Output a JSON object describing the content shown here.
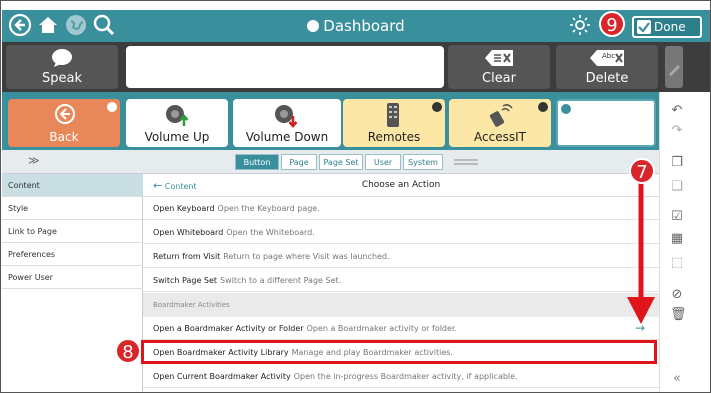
{
  "topbar": {
    "title": "Dashboard",
    "done_label": "Done",
    "icons": [
      "back-circle-icon",
      "home-icon",
      "globe-icon",
      "search-icon",
      "brightness-icon",
      "checkmark-icon"
    ]
  },
  "speech_row": {
    "speak_label": "Speak",
    "clear_label": "Clear",
    "delete_label": "Delete",
    "delete_icon_text": "Abc",
    "clear_icon_text": "="
  },
  "buttons": [
    {
      "label": "Back",
      "color": "#e8875a"
    },
    {
      "label": "Volume Up",
      "color": "#ffffff"
    },
    {
      "label": "Volume Down",
      "color": "#ffffff"
    },
    {
      "label": "Remotes",
      "color": "#fde7a7"
    },
    {
      "label": "AccessIT",
      "color": "#fde7a7"
    },
    {
      "label": "",
      "color": "#ffffff"
    }
  ],
  "tabs": [
    "Button",
    "Page",
    "Page Set",
    "User",
    "System"
  ],
  "active_tab": "Button",
  "left_nav": [
    "Content",
    "Style",
    "Link to Page",
    "Preferences",
    "Power User"
  ],
  "active_nav": "Content",
  "panel": {
    "back_label": "Content",
    "title": "Choose an Action",
    "actions_top": [
      {
        "name": "Open Keyboard",
        "desc": "Open the Keyboard page."
      },
      {
        "name": "Open Whiteboard",
        "desc": "Open the Whiteboard."
      },
      {
        "name": "Return from Visit",
        "desc": "Return to page where Visit was launched."
      },
      {
        "name": "Switch Page Set",
        "desc": "Switch to a different Page Set."
      }
    ],
    "section_label": "Boardmaker Activities",
    "actions_bottom": [
      {
        "name": "Open a Boardmaker Activity or Folder",
        "desc": "Open a Boardmaker activity or folder."
      },
      {
        "name": "Open Boardmaker Activity Library",
        "desc": "Manage and play Boardmaker activities."
      },
      {
        "name": "Open Current Boardmaker Activity",
        "desc": "Open the in-progress Boardmaker activity, if applicable."
      }
    ]
  },
  "annotations": {
    "step_done": "9",
    "step_arrow": "7",
    "step_item": "8",
    "accent": "#e0141b"
  }
}
